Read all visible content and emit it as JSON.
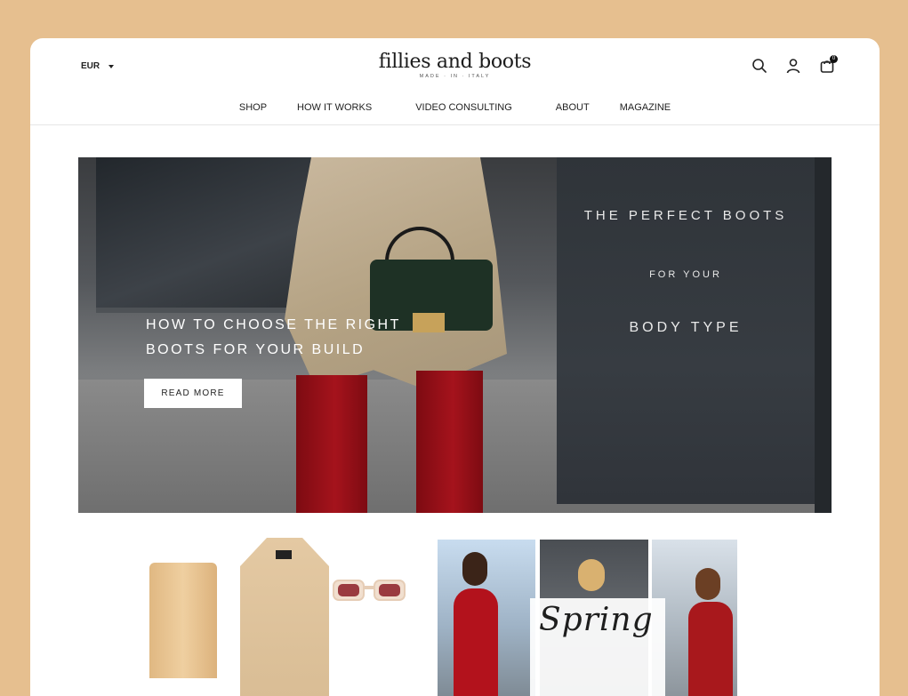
{
  "header": {
    "currency": "EUR",
    "logo_name": "fillies and boots",
    "logo_tagline": "MADE · IN · ITALY",
    "cart_count": "0",
    "icons": [
      "search-icon",
      "account-icon",
      "cart-icon"
    ]
  },
  "nav": {
    "items": [
      {
        "label": "SHOP"
      },
      {
        "label": "HOW IT WORKS"
      },
      {
        "label": "VIDEO CONSULTING"
      },
      {
        "label": "ABOUT"
      },
      {
        "label": "MAGAZINE"
      }
    ]
  },
  "hero": {
    "headline_line1": "HOW TO CHOOSE THE RIGHT",
    "headline_line2": "BOOTS FOR YOUR BUILD",
    "cta_label": "READ MORE",
    "wall_line1": "THE PERFECT BOOTS",
    "wall_line2": "FOR YOUR",
    "wall_line3": "BODY TYPE"
  },
  "teasers": {
    "collage_title": "Spring"
  },
  "colors": {
    "background": "#e6bf8f",
    "panel": "#ffffff",
    "text": "#222222"
  }
}
